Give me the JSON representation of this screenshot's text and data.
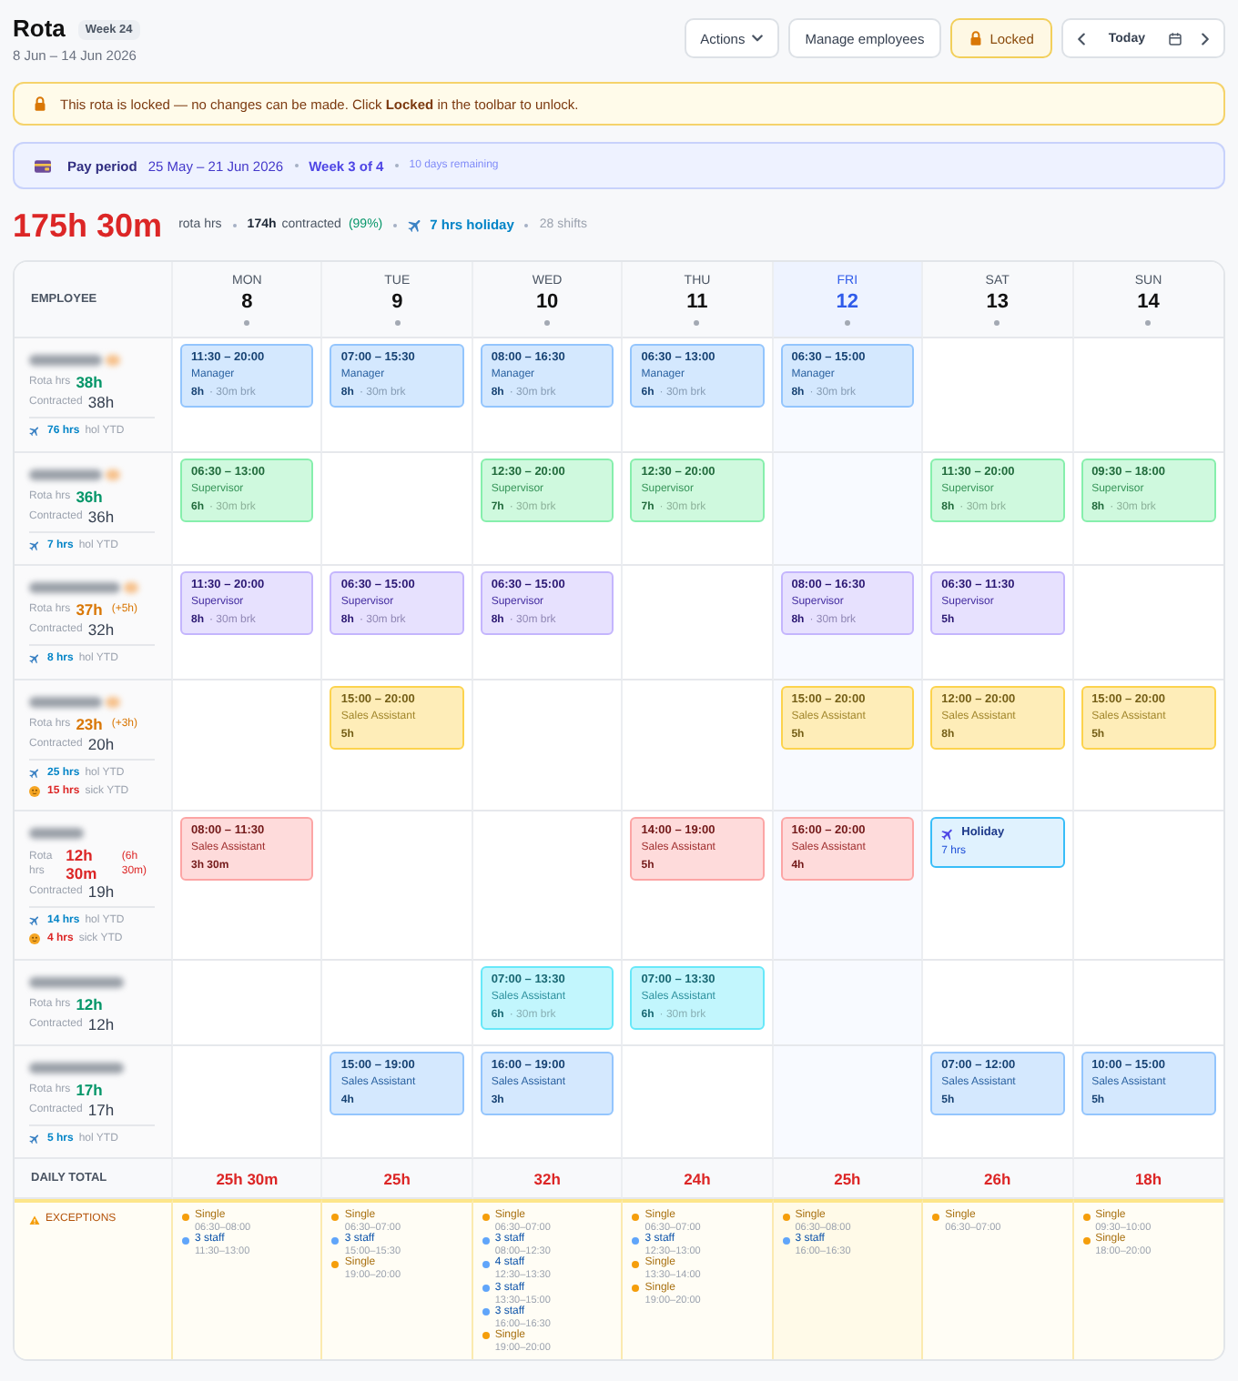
{
  "header": {
    "title": "Rota",
    "week_badge": "Week 24",
    "date_range": "8 Jun – 14 Jun 2026"
  },
  "toolbar": [
    {
      "kind": "menu",
      "label": "Actions"
    },
    {
      "kind": "button",
      "label": "Manage employees"
    },
    {
      "kind": "toggle",
      "label": "Locked",
      "on": true
    }
  ],
  "date_nav": {
    "today_label": "Today"
  },
  "lock_banner": {
    "text": "This rota is locked — no changes can be made. Click **Locked** in the toolbar to unlock."
  },
  "pay_period": {
    "label": "Pay period",
    "dates": "25 May – 21 Jun 2026",
    "week": "Week 3 of 4",
    "remaining": "10 days remaining"
  },
  "summary": {
    "total": "175h 30m",
    "total_label": "rota hrs",
    "contracted": "174h",
    "contracted_label": "contracted",
    "percent": "(99%)",
    "holiday": "7 hrs holiday",
    "shifts": "28 shifts"
  },
  "table": {
    "employee_heading": "EMPLOYEE",
    "days": [
      {
        "name": "MON",
        "date": "8",
        "today": false
      },
      {
        "name": "TUE",
        "date": "9",
        "today": false
      },
      {
        "name": "WED",
        "date": "10",
        "today": false
      },
      {
        "name": "THU",
        "date": "11",
        "today": false
      },
      {
        "name": "FRI",
        "date": "12",
        "today": true
      },
      {
        "name": "SAT",
        "date": "13",
        "today": false
      },
      {
        "name": "SUN",
        "date": "14",
        "today": false
      }
    ],
    "employees": [
      {
        "color": "#93c5fd",
        "rota_label": "Rota hrs",
        "rota": "38h",
        "over_hours": false,
        "under_hours": false,
        "contracted_label": "Contracted",
        "contracted": "38h",
        "ytd": [
          {
            "kind": "holiday",
            "hours": "76 hrs",
            "caption": "hol YTD"
          }
        ],
        "days": [
          {
            "kind": "shift",
            "time": "11:30 – 20:00",
            "role": "Manager",
            "hours": "8h",
            "break": "· 30m brk"
          },
          {
            "kind": "shift",
            "time": "07:00 – 15:30",
            "role": "Manager",
            "hours": "8h",
            "break": "· 30m brk"
          },
          {
            "kind": "shift",
            "time": "08:00 – 16:30",
            "role": "Manager",
            "hours": "8h",
            "break": "· 30m brk"
          },
          {
            "kind": "shift",
            "time": "06:30 – 13:00",
            "role": "Manager",
            "hours": "6h",
            "break": "· 30m brk"
          },
          {
            "kind": "shift",
            "time": "06:30 – 15:00",
            "role": "Manager",
            "hours": "8h",
            "break": "· 30m brk"
          },
          {
            "kind": "off"
          },
          {
            "kind": "off"
          }
        ]
      },
      {
        "color": "#86efac",
        "rota_label": "Rota hrs",
        "rota": "36h",
        "over_hours": false,
        "under_hours": false,
        "contracted_label": "Contracted",
        "contracted": "36h",
        "ytd": [
          {
            "kind": "holiday",
            "hours": "7 hrs",
            "caption": "hol YTD"
          }
        ],
        "days": [
          {
            "kind": "shift",
            "time": "06:30 – 13:00",
            "role": "Supervisor",
            "hours": "6h",
            "break": "· 30m brk"
          },
          {
            "kind": "off"
          },
          {
            "kind": "shift",
            "time": "12:30 – 20:00",
            "role": "Supervisor",
            "hours": "7h",
            "break": "· 30m brk"
          },
          {
            "kind": "shift",
            "time": "12:30 – 20:00",
            "role": "Supervisor",
            "hours": "7h",
            "break": "· 30m brk"
          },
          {
            "kind": "off"
          },
          {
            "kind": "shift",
            "time": "11:30 – 20:00",
            "role": "Supervisor",
            "hours": "8h",
            "break": "· 30m brk"
          },
          {
            "kind": "shift",
            "time": "09:30 – 18:00",
            "role": "Supervisor",
            "hours": "8h",
            "break": "· 30m brk"
          }
        ]
      },
      {
        "color": "#c4b5fd",
        "rota_label": "Rota hrs",
        "rota": "37h",
        "over_hours": true,
        "under_hours": false,
        "difference": "(+5h)",
        "contracted_label": "Contracted",
        "contracted": "32h",
        "ytd": [
          {
            "kind": "holiday",
            "hours": "8 hrs",
            "caption": "hol YTD"
          }
        ],
        "days": [
          {
            "kind": "shift",
            "time": "11:30 – 20:00",
            "role": "Supervisor",
            "hours": "8h",
            "break": "· 30m brk"
          },
          {
            "kind": "shift",
            "time": "06:30 – 15:00",
            "role": "Supervisor",
            "hours": "8h",
            "break": "· 30m brk"
          },
          {
            "kind": "shift",
            "time": "06:30 – 15:00",
            "role": "Supervisor",
            "hours": "8h",
            "break": "· 30m brk"
          },
          {
            "kind": "off"
          },
          {
            "kind": "shift",
            "time": "08:00 – 16:30",
            "role": "Supervisor",
            "hours": "8h",
            "break": "· 30m brk"
          },
          {
            "kind": "shift",
            "time": "06:30 – 11:30",
            "role": "Supervisor",
            "hours": "5h"
          },
          {
            "kind": "off"
          }
        ]
      },
      {
        "color": "#fcd34d",
        "rota_label": "Rota hrs",
        "rota": "23h",
        "over_hours": true,
        "under_hours": false,
        "difference": "(+3h)",
        "contracted_label": "Contracted",
        "contracted": "20h",
        "ytd": [
          {
            "kind": "holiday",
            "hours": "25 hrs",
            "caption": "hol YTD"
          },
          {
            "kind": "sick",
            "hours": "15 hrs",
            "caption": "sick YTD"
          }
        ],
        "days": [
          {
            "kind": "off"
          },
          {
            "kind": "shift",
            "time": "15:00 – 20:00",
            "role": "Sales Assistant",
            "hours": "5h"
          },
          {
            "kind": "off"
          },
          {
            "kind": "off"
          },
          {
            "kind": "shift",
            "time": "15:00 – 20:00",
            "role": "Sales Assistant",
            "hours": "5h"
          },
          {
            "kind": "shift",
            "time": "12:00 – 20:00",
            "role": "Sales Assistant",
            "hours": "8h"
          },
          {
            "kind": "shift",
            "time": "15:00 – 20:00",
            "role": "Sales Assistant",
            "hours": "5h"
          }
        ]
      },
      {
        "color": "#fca5a5",
        "rota_label": "Rota hrs",
        "rota": "12h 30m",
        "over_hours": false,
        "under_hours": true,
        "difference": "(6h 30m)",
        "contracted_label": "Contracted",
        "contracted": "19h",
        "ytd": [
          {
            "kind": "holiday",
            "hours": "14 hrs",
            "caption": "hol YTD"
          },
          {
            "kind": "sick",
            "hours": "4 hrs",
            "caption": "sick YTD"
          }
        ],
        "days": [
          {
            "kind": "shift",
            "time": "08:00 – 11:30",
            "role": "Sales Assistant",
            "hours": "3h 30m"
          },
          {
            "kind": "off"
          },
          {
            "kind": "off"
          },
          {
            "kind": "shift",
            "time": "14:00 – 19:00",
            "role": "Sales Assistant",
            "hours": "5h"
          },
          {
            "kind": "shift",
            "time": "16:00 – 20:00",
            "role": "Sales Assistant",
            "hours": "4h"
          },
          {
            "kind": "holiday",
            "label": "Holiday",
            "hours": "7 hrs"
          },
          {
            "kind": "off"
          }
        ]
      },
      {
        "color": "#67e8f9",
        "rota_label": "Rota hrs",
        "rota": "12h",
        "over_hours": false,
        "under_hours": false,
        "contracted_label": "Contracted",
        "contracted": "12h",
        "days": [
          {
            "kind": "off"
          },
          {
            "kind": "off"
          },
          {
            "kind": "shift",
            "time": "07:00 – 13:30",
            "role": "Sales Assistant",
            "hours": "6h",
            "break": "· 30m brk"
          },
          {
            "kind": "shift",
            "time": "07:00 – 13:30",
            "role": "Sales Assistant",
            "hours": "6h",
            "break": "· 30m brk"
          },
          {
            "kind": "off"
          },
          {
            "kind": "off"
          },
          {
            "kind": "off"
          }
        ]
      },
      {
        "color": "#93c5fd",
        "rota_label": "Rota hrs",
        "rota": "17h",
        "over_hours": false,
        "under_hours": false,
        "contracted_label": "Contracted",
        "contracted": "17h",
        "ytd": [
          {
            "kind": "holiday",
            "hours": "5 hrs",
            "caption": "hol YTD"
          }
        ],
        "days": [
          {
            "kind": "off"
          },
          {
            "kind": "shift",
            "time": "15:00 – 19:00",
            "role": "Sales Assistant",
            "hours": "4h"
          },
          {
            "kind": "shift",
            "time": "16:00 – 19:00",
            "role": "Sales Assistant",
            "hours": "3h"
          },
          {
            "kind": "off"
          },
          {
            "kind": "off"
          },
          {
            "kind": "shift",
            "time": "07:00 – 12:00",
            "role": "Sales Assistant",
            "hours": "5h"
          },
          {
            "kind": "shift",
            "time": "10:00 – 15:00",
            "role": "Sales Assistant",
            "hours": "5h"
          }
        ]
      }
    ],
    "totals_label": "DAILY TOTAL",
    "totals": [
      "25h 30m",
      "25h",
      "32h",
      "24h",
      "25h",
      "26h",
      "18h"
    ],
    "exceptions_label": "EXCEPTIONS",
    "exceptions": [
      [
        {
          "label": "Single",
          "time": "06:30–08:00",
          "color": "#f59e0b"
        },
        {
          "label": "3 staff",
          "time": "11:30–13:00",
          "color": "#60a5fa"
        }
      ],
      [
        {
          "label": "Single",
          "time": "06:30–07:00",
          "color": "#f59e0b"
        },
        {
          "label": "3 staff",
          "time": "15:00–15:30",
          "color": "#60a5fa"
        },
        {
          "label": "Single",
          "time": "19:00–20:00",
          "color": "#f59e0b"
        }
      ],
      [
        {
          "label": "Single",
          "time": "06:30–07:00",
          "color": "#f59e0b"
        },
        {
          "label": "3 staff",
          "time": "08:00–12:30",
          "color": "#60a5fa"
        },
        {
          "label": "4 staff",
          "time": "12:30–13:30",
          "color": "#60a5fa"
        },
        {
          "label": "3 staff",
          "time": "13:30–15:00",
          "color": "#60a5fa"
        },
        {
          "label": "3 staff",
          "time": "16:00–16:30",
          "color": "#60a5fa"
        },
        {
          "label": "Single",
          "time": "19:00–20:00",
          "color": "#f59e0b"
        }
      ],
      [
        {
          "label": "Single",
          "time": "06:30–07:00",
          "color": "#f59e0b"
        },
        {
          "label": "3 staff",
          "time": "12:30–13:00",
          "color": "#60a5fa"
        },
        {
          "label": "Single",
          "time": "13:30–14:00",
          "color": "#f59e0b"
        },
        {
          "label": "Single",
          "time": "19:00–20:00",
          "color": "#f59e0b"
        }
      ],
      [
        {
          "label": "Single",
          "time": "06:30–08:00",
          "color": "#f59e0b"
        },
        {
          "label": "3 staff",
          "time": "16:00–16:30",
          "color": "#60a5fa"
        }
      ],
      [
        {
          "label": "Single",
          "time": "06:30–07:00",
          "color": "#f59e0b"
        }
      ],
      [
        {
          "label": "Single",
          "time": "09:30–10:00",
          "color": "#f59e0b"
        },
        {
          "label": "Single",
          "time": "18:00–20:00",
          "color": "#f59e0b"
        }
      ]
    ]
  }
}
